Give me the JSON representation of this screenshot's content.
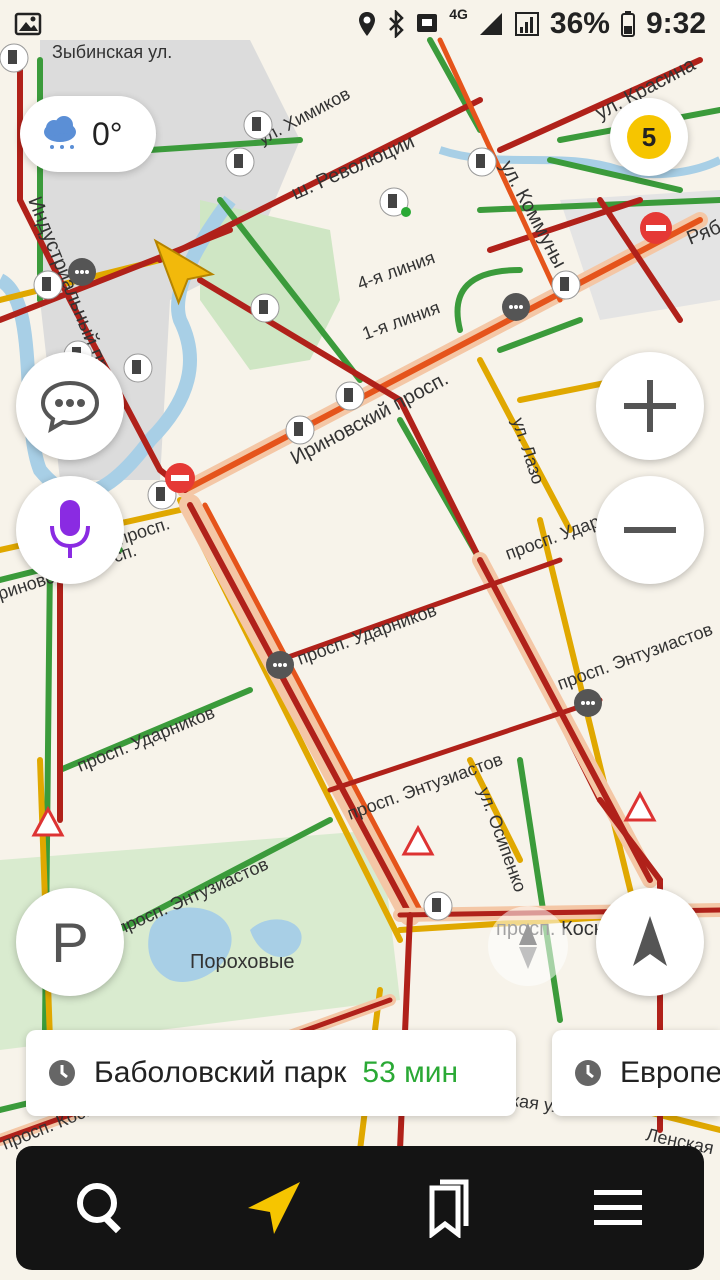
{
  "status_bar": {
    "network": "4G",
    "battery": "36%",
    "time": "9:32"
  },
  "weather": {
    "temperature": "0°",
    "icon": "snow-cloud-icon"
  },
  "traffic": {
    "score": "5"
  },
  "map": {
    "streets": {
      "zybinskaya": "Зыбинская ул.",
      "khimikov": "ул. Химиков",
      "revolyutsii": "ш. Революции",
      "kommuny": "ул. Коммуны",
      "krasina": "ул. Красина",
      "industrialny": "Индустриальный просп.",
      "line4": "4-я линия",
      "line1": "1-я линия",
      "irinovsky": "Ириновский просп.",
      "lazo": "ул. Лазо",
      "udarnikov_right": "просп. Ударников",
      "udarnikov_mid": "просп. Ударников",
      "udarnikov_left": "просп. Ударников",
      "entuziastov_right": "просп. Энтузиастов",
      "entuziastov_mid": "просп. Энтузиастов",
      "entuziastov_left": "просп. Энтузиастов",
      "osipenko": "ул. Осипенко",
      "kosygina": "просп. Косыгина",
      "kosygina_left": "просп. Косыгина",
      "lenskaya": "Ленская ул.",
      "lenskaya2": "Ленская",
      "ryab": "Ряб",
      "irinovsky_left": "риновский просп.",
      "porokhovye": "Пороховые",
      "irinovsky_short": "просп."
    }
  },
  "side_buttons": {
    "chat": "chat-icon",
    "voice": "microphone-icon",
    "parking": "P",
    "zoom_in": "plus-icon",
    "zoom_out": "minus-icon",
    "compass": "compass-icon"
  },
  "route_cards": [
    {
      "name": "Баболовский парк",
      "time": "53 мин"
    },
    {
      "name": "Европе",
      "time": ""
    }
  ],
  "bottom_nav": {
    "search": "search-icon",
    "navigator": "navigator-arrow-icon",
    "bookmarks": "bookmarks-icon",
    "menu": "menu-icon"
  },
  "colors": {
    "traffic_red": "#b0211a",
    "traffic_orange": "#e5541b",
    "traffic_yellow": "#e0a800",
    "traffic_green": "#3b9b3b",
    "accent_yellow": "#f6c500",
    "green_time": "#2aa935",
    "voice_purple": "#8a2be2"
  }
}
